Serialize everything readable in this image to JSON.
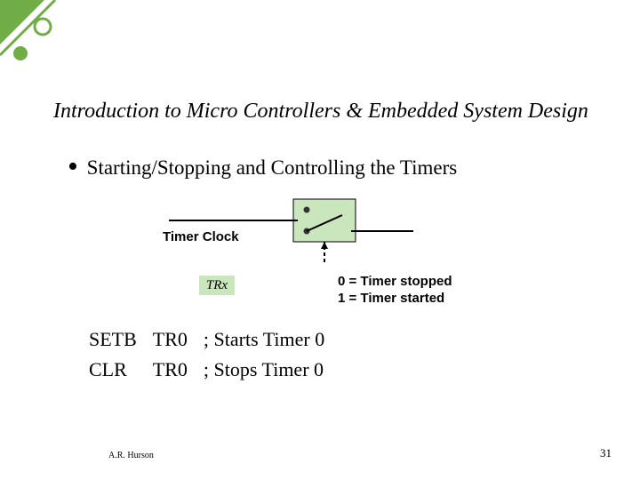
{
  "title": "Introduction to Micro Controllers & Embedded System Design",
  "bullet": "Starting/Stopping and Controlling the Timers",
  "diagram": {
    "timer_clock_label": "Timer Clock",
    "trx_label": "TRx",
    "legend_line1": "0 = Timer stopped",
    "legend_line2": "1 = Timer started"
  },
  "code": [
    {
      "mnemonic": "SETB",
      "operand": "TR0",
      "comment": "; Starts Timer 0"
    },
    {
      "mnemonic": "CLR",
      "operand": "TR0",
      "comment": "; Stops Timer 0"
    }
  ],
  "footer": {
    "author": "A.R. Hurson",
    "page": "31"
  },
  "colors": {
    "accent_green": "#70ad47",
    "box_fill": "#c9e6bd"
  }
}
